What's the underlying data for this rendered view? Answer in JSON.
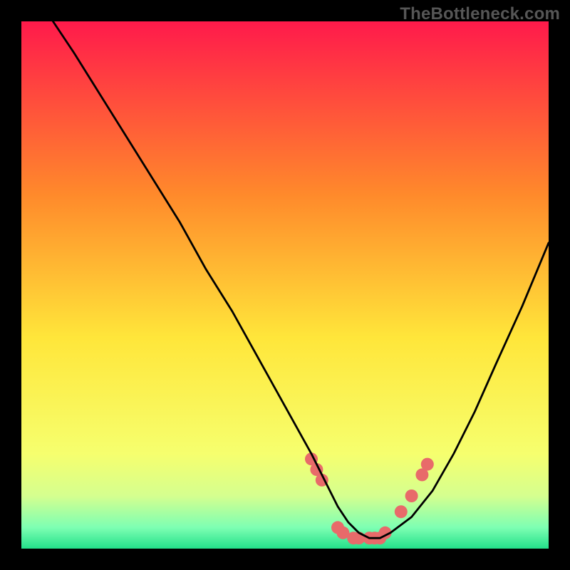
{
  "watermark": "TheBottleneck.com",
  "chart_data": {
    "type": "line",
    "title": "",
    "xlabel": "",
    "ylabel": "",
    "xlim": [
      0,
      100
    ],
    "ylim": [
      0,
      100
    ],
    "grid": false,
    "legend": false,
    "gradient_stops": [
      {
        "offset": 0,
        "color": "#ff1a4b"
      },
      {
        "offset": 33,
        "color": "#ff8a2b"
      },
      {
        "offset": 60,
        "color": "#ffe63a"
      },
      {
        "offset": 82,
        "color": "#f6ff6e"
      },
      {
        "offset": 90,
        "color": "#d5ff8f"
      },
      {
        "offset": 96,
        "color": "#7dffb3"
      },
      {
        "offset": 100,
        "color": "#23e08a"
      }
    ],
    "series": [
      {
        "name": "bottleneck-curve",
        "x": [
          6,
          10,
          15,
          20,
          25,
          30,
          35,
          40,
          45,
          50,
          55,
          58,
          60,
          62,
          64,
          66,
          68,
          70,
          74,
          78,
          82,
          86,
          90,
          95,
          100
        ],
        "y": [
          100,
          94,
          86,
          78,
          70,
          62,
          53,
          45,
          36,
          27,
          18,
          12,
          8,
          5,
          3,
          2,
          2,
          3,
          6,
          11,
          18,
          26,
          35,
          46,
          58
        ]
      }
    ],
    "markers": {
      "name": "highlight-points",
      "color": "#e86a6a",
      "radius_px": 9,
      "x": [
        55,
        56,
        57,
        60,
        61,
        63,
        64,
        66,
        67,
        68,
        69,
        72,
        74,
        76,
        77
      ],
      "y": [
        17,
        15,
        13,
        4,
        3,
        2,
        2,
        2,
        2,
        2,
        3,
        7,
        10,
        14,
        16
      ]
    }
  }
}
